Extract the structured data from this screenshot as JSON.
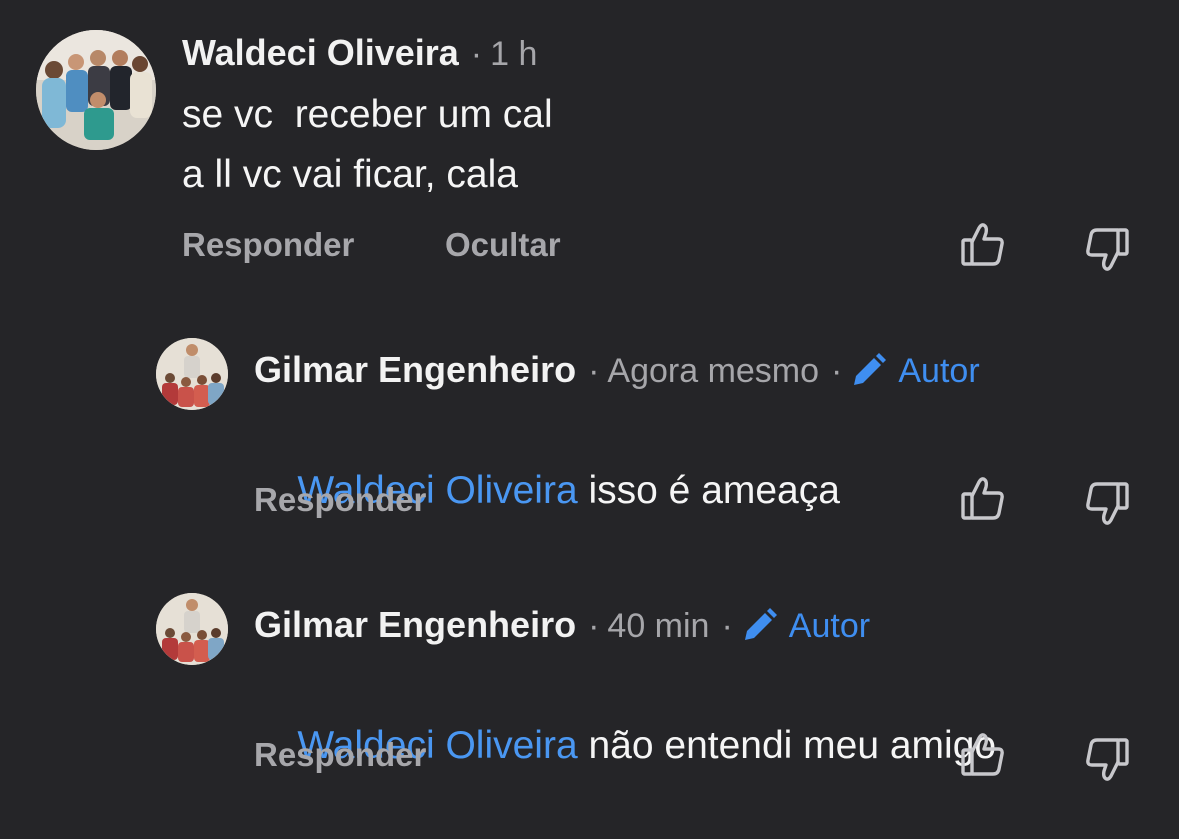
{
  "comments": [
    {
      "author": "Waldeci Oliveira",
      "time": "1 h",
      "lines": [
        "se vc  receber um cal",
        "a ll vc vai ficar, cala"
      ],
      "actions": {
        "reply": "Responder",
        "hide": "Ocultar"
      }
    },
    {
      "author": "Gilmar Engenheiro",
      "time": "Agora mesmo",
      "badge": "Autor",
      "mention": "Waldeci Oliveira",
      "text": " isso é ameaça",
      "actions": {
        "reply": "Responder"
      }
    },
    {
      "author": "Gilmar Engenheiro",
      "time": "40 min",
      "badge": "Autor",
      "mention": "Waldeci Oliveira",
      "text": " não entendi meu amigo",
      "actions": {
        "reply": "Responder"
      }
    }
  ],
  "separator": "·",
  "icons": {
    "like": "thumbs-up-icon",
    "dislike": "thumbs-down-icon",
    "badge": "pencil-icon"
  },
  "colors": {
    "background": "#252528",
    "link": "#4a97f2",
    "muted": "#a7a7ab"
  }
}
